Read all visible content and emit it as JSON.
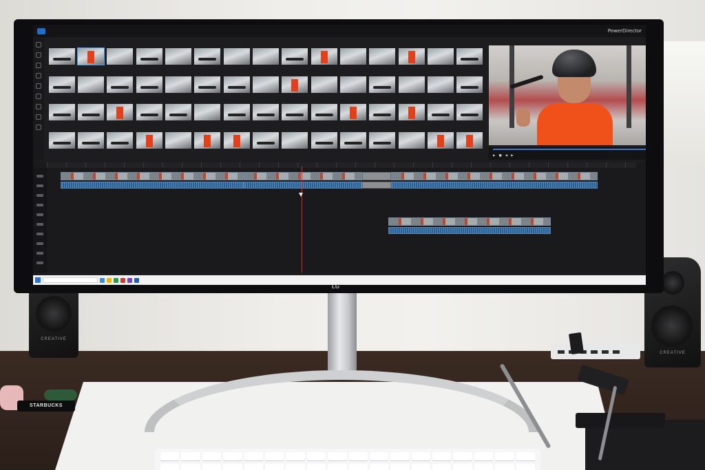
{
  "monitor": {
    "brand": "LG"
  },
  "app": {
    "name": "PowerDirector",
    "title": "",
    "library_thumbs": [
      {
        "kind": "scooter"
      },
      {
        "kind": "orange"
      },
      {
        "kind": "plain"
      },
      {
        "kind": "scooter"
      },
      {
        "kind": "plain"
      },
      {
        "kind": "scooter"
      },
      {
        "kind": "plain"
      },
      {
        "kind": "plain"
      },
      {
        "kind": "scooter"
      },
      {
        "kind": "orange"
      },
      {
        "kind": "plain"
      },
      {
        "kind": "plain"
      },
      {
        "kind": "orange"
      },
      {
        "kind": "plain"
      },
      {
        "kind": "scooter"
      },
      {
        "kind": "scooter"
      },
      {
        "kind": "plain"
      },
      {
        "kind": "scooter"
      },
      {
        "kind": "scooter"
      },
      {
        "kind": "plain"
      },
      {
        "kind": "scooter"
      },
      {
        "kind": "scooter"
      },
      {
        "kind": "plain"
      },
      {
        "kind": "orange"
      },
      {
        "kind": "plain"
      },
      {
        "kind": "plain"
      },
      {
        "kind": "scooter"
      },
      {
        "kind": "plain"
      },
      {
        "kind": "plain"
      },
      {
        "kind": "scooter"
      },
      {
        "kind": "scooter"
      },
      {
        "kind": "scooter"
      },
      {
        "kind": "orange"
      },
      {
        "kind": "scooter"
      },
      {
        "kind": "scooter"
      },
      {
        "kind": "plain"
      },
      {
        "kind": "scooter"
      },
      {
        "kind": "scooter"
      },
      {
        "kind": "scooter"
      },
      {
        "kind": "scooter"
      },
      {
        "kind": "orange"
      },
      {
        "kind": "scooter"
      },
      {
        "kind": "orange"
      },
      {
        "kind": "scooter"
      },
      {
        "kind": "scooter"
      },
      {
        "kind": "scooter"
      },
      {
        "kind": "scooter"
      },
      {
        "kind": "scooter"
      },
      {
        "kind": "orange"
      },
      {
        "kind": "plain"
      },
      {
        "kind": "orange"
      },
      {
        "kind": "orange"
      },
      {
        "kind": "scooter"
      },
      {
        "kind": "plain"
      },
      {
        "kind": "scooter"
      },
      {
        "kind": "scooter"
      },
      {
        "kind": "scooter"
      },
      {
        "kind": "plain"
      },
      {
        "kind": "orange"
      },
      {
        "kind": "orange"
      }
    ],
    "accent": "#3a7bd5",
    "playhead_color": "#d62a2a"
  },
  "desk_items": {
    "keychain_text": "STARBUCKS",
    "speaker_brand": "CREATIVE"
  }
}
